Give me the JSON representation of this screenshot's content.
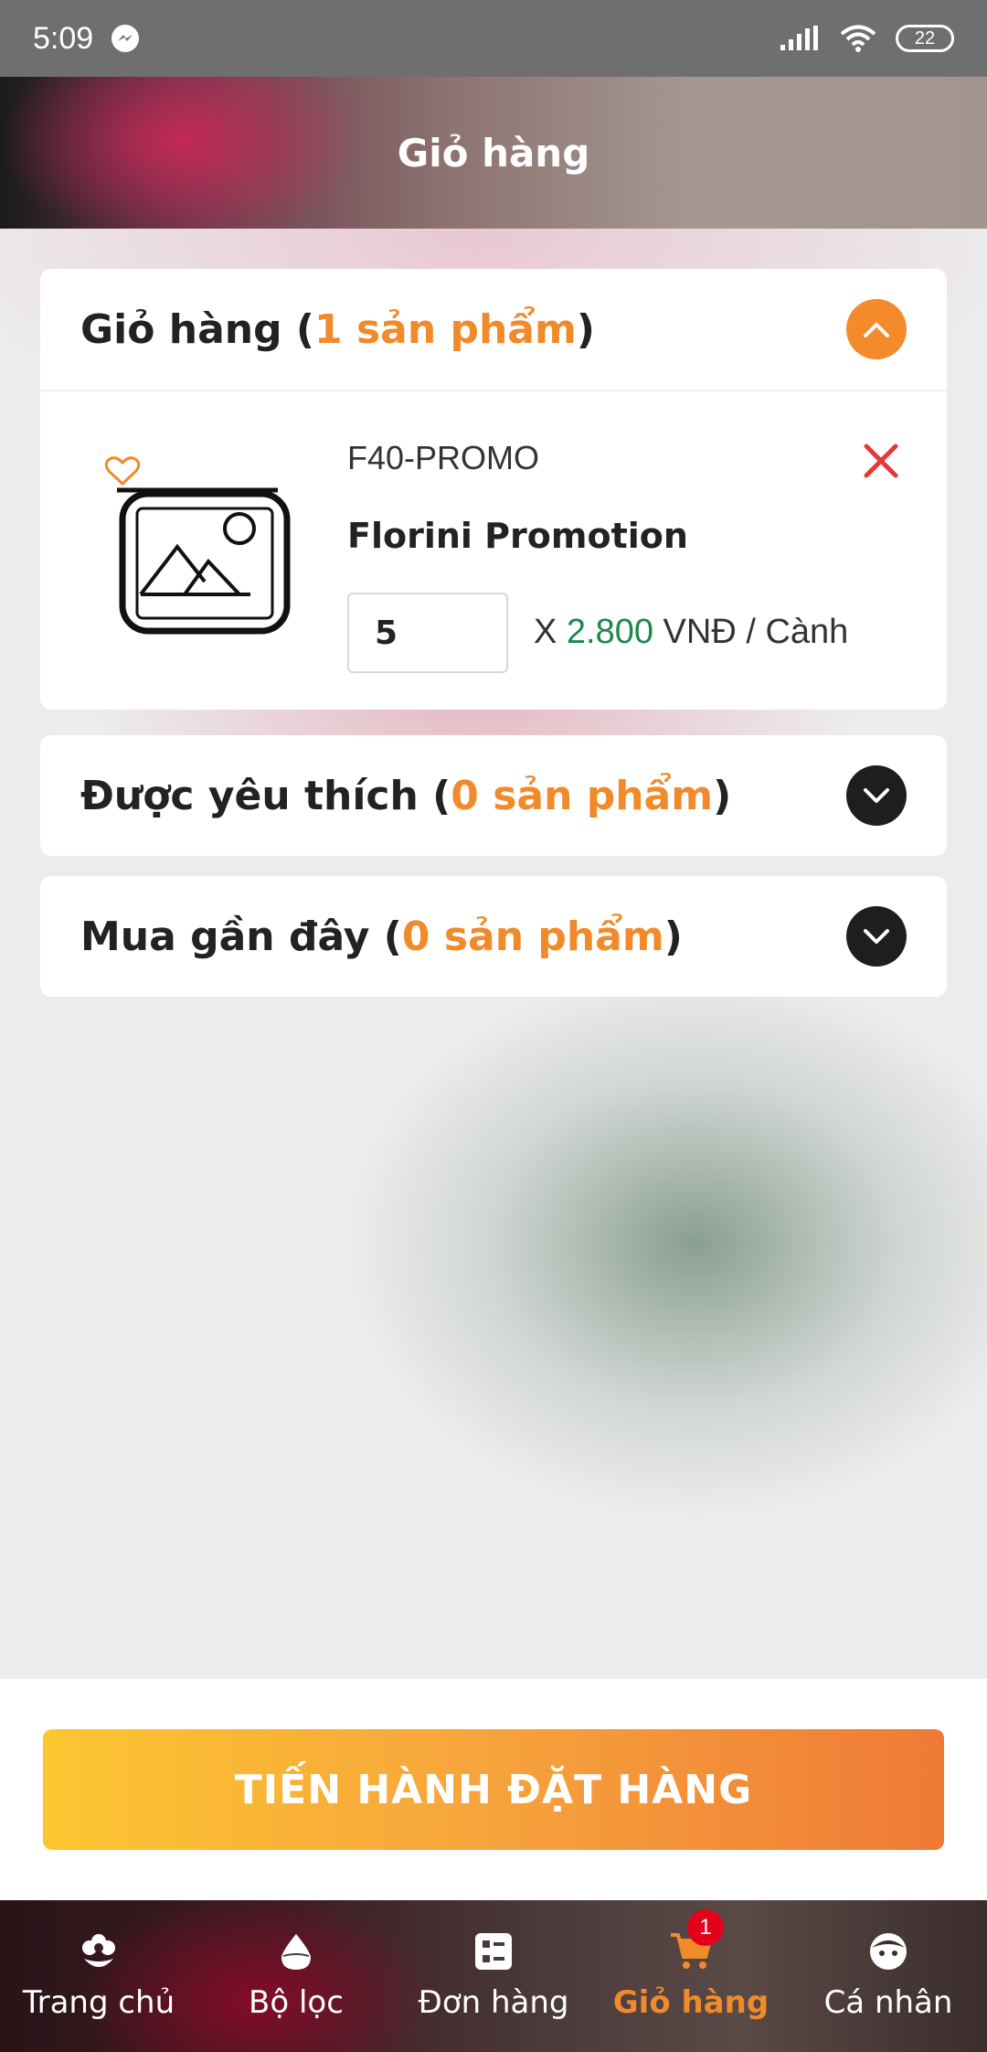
{
  "status_bar": {
    "time": "5:09",
    "battery": "22"
  },
  "header": {
    "title": "Giỏ hàng"
  },
  "cart_section": {
    "title": "Giỏ hàng (",
    "count": "1 sản phẩm",
    "close_paren": ")",
    "items": [
      {
        "sku": "F40-PROMO",
        "name": "Florini Promotion",
        "quantity": "5",
        "times": "X ",
        "price": "2.800",
        "unit": " VNĐ / Cành"
      }
    ]
  },
  "favorites_section": {
    "title": "Được yêu thích (",
    "count": "0 sản phẩm",
    "close_paren": ")"
  },
  "recent_section": {
    "title": "Mua gần đây (",
    "count": "0 sản phẩm",
    "close_paren": ")"
  },
  "order_button": {
    "label": "TIẾN HÀNH ĐẶT HÀNG"
  },
  "bottom_nav": {
    "items": [
      {
        "label": "Trang chủ",
        "icon": "flower-icon"
      },
      {
        "label": "Bộ lọc",
        "icon": "drop-icon"
      },
      {
        "label": "Đơn hàng",
        "icon": "list-icon"
      },
      {
        "label": "Giỏ hàng",
        "icon": "cart-icon",
        "badge": "1",
        "active": true
      },
      {
        "label": "Cá nhân",
        "icon": "face-icon"
      }
    ]
  },
  "colors": {
    "accent": "#f08a2a",
    "price": "#1a8a4a",
    "remove": "#e53935",
    "badge": "#e4001b"
  }
}
